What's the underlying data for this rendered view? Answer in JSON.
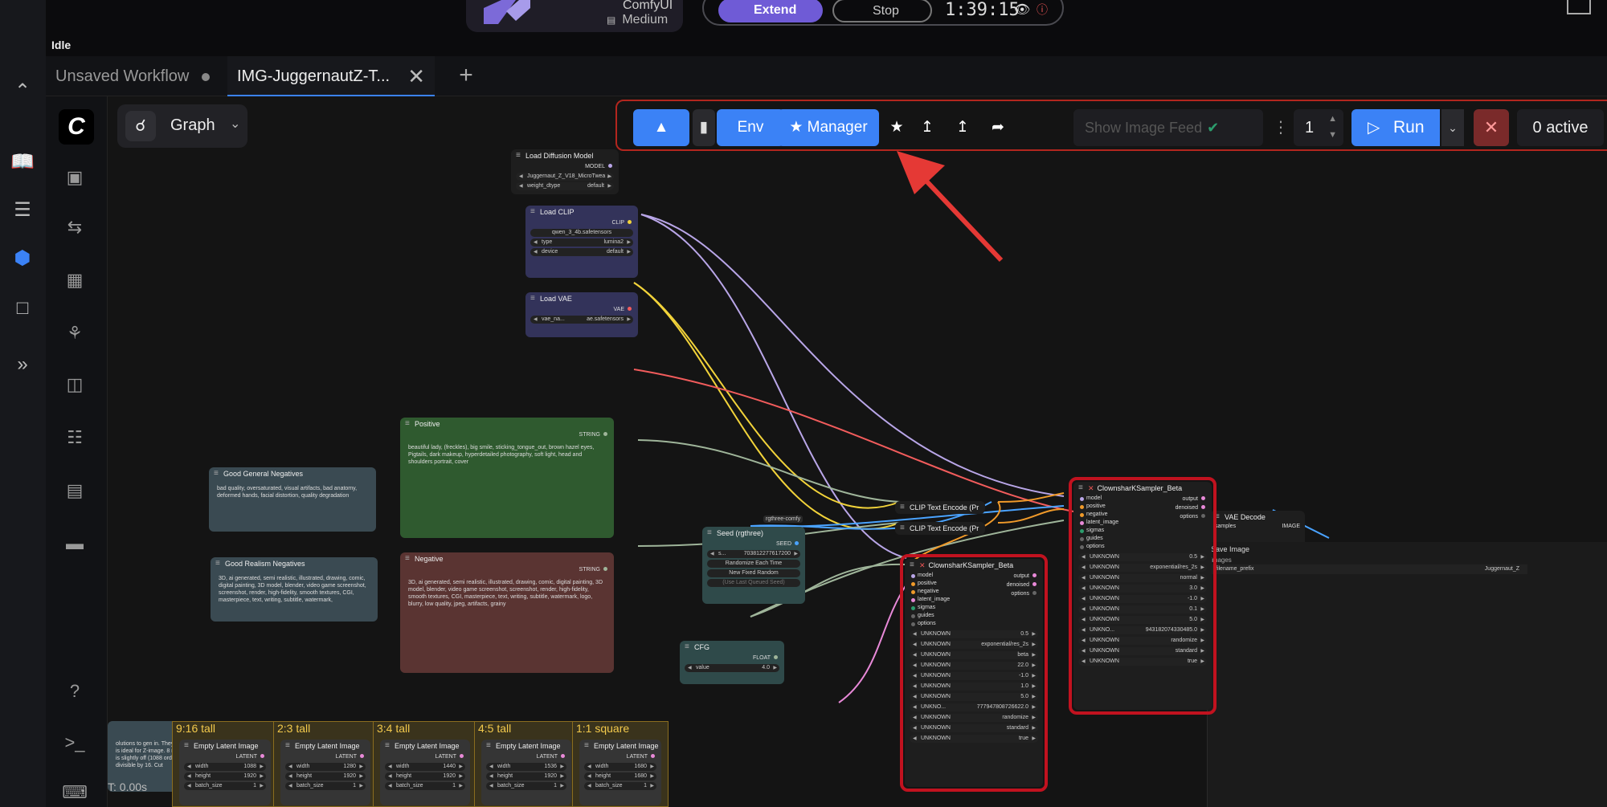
{
  "top": {
    "brand_name": "ComfyUI",
    "tier": "Medium",
    "extend_label": "Extend",
    "stop_label": "Stop",
    "timer": "1:39:15",
    "status": "Idle"
  },
  "tabs": [
    {
      "label": "Unsaved Workflow"
    },
    {
      "label": "IMG-JuggernautZ-T..."
    }
  ],
  "graph_menu": {
    "label": "Graph"
  },
  "toolbar": {
    "env_label": "Env",
    "manager_label": "Manager",
    "image_feed_label": "Show Image Feed",
    "queue_count": "1",
    "run_label": "Run",
    "active_label": "0 active"
  },
  "nodes": {
    "load_diffusion": {
      "title": "Load Diffusion Model",
      "out": "MODEL",
      "w1": "Juggernaut_Z_V18_MicroTwea ...",
      "w2l": "weight_dtype",
      "w2r": "default"
    },
    "load_clip": {
      "title": "Load CLIP",
      "out": "CLIP",
      "w1": "qwen_3_4b.safetensors",
      "w2l": "type",
      "w2r": "lumina2",
      "w3l": "device",
      "w3r": "default"
    },
    "load_vae": {
      "title": "Load VAE",
      "out": "VAE",
      "w1l": "vae_na...",
      "w1r": "ae.safetensors"
    },
    "positive": {
      "title": "Positive",
      "out": "STRING",
      "text": "beautiful lady, (freckles), big smile, sticking_tongue_out, brown hazel eyes, Pigtails, dark makeup, hyperdetailed photography, soft light, head and shoulders portrait, cover"
    },
    "negative": {
      "title": "Negative",
      "out": "STRING",
      "text": "3D, ai generated, semi realistic, illustrated, drawing, comic, digital painting, 3D model, blender, video game screenshot, screenshot, render, high-fidelity, smooth textures, CGI, masterpiece, text, writing, subtitle, watermark, logo, blurry, low quality, jpeg, artifacts, grainy"
    },
    "good_general": {
      "title": "Good General Negatives",
      "text": "bad quality, oversaturated, visual artifacts, bad anatomy, deformed hands, facial distortion, quality degradation"
    },
    "good_realism": {
      "title": "Good Realism Negatives",
      "text": "3D, ai generated, semi realistic, illustrated, drawing, comic, digital painting, 3D model, blender, video game screenshot, screenshot, render, high-fidelity, smooth textures, CGI, masterpiece, text, writing, subtitle, watermark,"
    },
    "seed": {
      "badge": "rgthree-comfy",
      "title": "Seed (rgthree)",
      "out": "SEED",
      "w1l": "s...",
      "w1r": "703812277617200",
      "b1": "Randomize Each Time",
      "b2": "New Fixed Random",
      "b3": "(Use Last Queued Seed)"
    },
    "cfg": {
      "title": "CFG",
      "out": "FLOAT",
      "wl": "value",
      "wr": "4.0"
    },
    "clip_enc1": {
      "title": "CLIP Text Encode (Pr"
    },
    "clip_enc2": {
      "title": "CLIP Text Encode (Pr"
    },
    "vae_decode": {
      "title": "VAE Decode",
      "in": "samples",
      "out": "IMAGE"
    },
    "save_image": {
      "title": "Save Image",
      "images": "images",
      "wl": "filename_prefix",
      "wr": "Juggernaut_Z"
    },
    "sampler1": {
      "title": "ClownsharKSampler_Beta",
      "inputs": [
        "model",
        "positive",
        "negative",
        "latent_image",
        "sigmas",
        "guides",
        "options"
      ],
      "outputs": [
        "output",
        "denoised",
        "options"
      ],
      "widgets": [
        [
          "UNKNOWN",
          "0.5"
        ],
        [
          "UNKNOWN",
          "exponential/res_2s"
        ],
        [
          "UNKNOWN",
          "beta"
        ],
        [
          "UNKNOWN",
          "22.0"
        ],
        [
          "UNKNOWN",
          "-1.0"
        ],
        [
          "UNKNOWN",
          "1.0"
        ],
        [
          "UNKNOWN",
          "5.0"
        ],
        [
          "UNKNO...",
          "777947808726622.0"
        ],
        [
          "UNKNOWN",
          "randomize"
        ],
        [
          "UNKNOWN",
          "standard"
        ],
        [
          "UNKNOWN",
          "true"
        ]
      ]
    },
    "sampler2": {
      "title": "ClownsharKSampler_Beta",
      "inputs": [
        "model",
        "positive",
        "negative",
        "latent_image",
        "sigmas",
        "guides",
        "options"
      ],
      "outputs": [
        "output",
        "denoised",
        "options"
      ],
      "widgets": [
        [
          "UNKNOWN",
          "0.5"
        ],
        [
          "UNKNOWN",
          "exponential/res_2s"
        ],
        [
          "UNKNOWN",
          "normal"
        ],
        [
          "UNKNOWN",
          "3.0"
        ],
        [
          "UNKNOWN",
          "-1.0"
        ],
        [
          "UNKNOWN",
          "0.1"
        ],
        [
          "UNKNOWN",
          "5.0"
        ],
        [
          "UNKNO...",
          "943182074330485.0"
        ],
        [
          "UNKNOWN",
          "randomize"
        ],
        [
          "UNKNOWN",
          "standard"
        ],
        [
          "UNKNOWN",
          "true"
        ]
      ]
    }
  },
  "groups": [
    {
      "label": "9:16 tall",
      "node": "Empty Latent Image",
      "width": "1088",
      "height": "1920",
      "batch": "1"
    },
    {
      "label": "2:3 tall",
      "node": "Empty Latent Image",
      "width": "1280",
      "height": "1920",
      "batch": "1"
    },
    {
      "label": "3:4 tall",
      "node": "Empty Latent Image",
      "width": "1440",
      "height": "1920",
      "batch": "1"
    },
    {
      "label": "4:5 tall",
      "node": "Empty Latent Image",
      "width": "1536",
      "height": "1920",
      "batch": "1"
    },
    {
      "label": "1:1 square",
      "node": "Empty Latent Image",
      "width": "1680",
      "height": "1680",
      "batch": "1"
    }
  ],
  "latent_labels": {
    "out": "LATENT",
    "w": "width",
    "h": "height",
    "b": "batch_size"
  },
  "note": {
    "text": "olutions to gen in. They are all h is ideal for Z-image. 8 resolution is slightly off (1088 order to be divisible by 16. Cut"
  },
  "timing": "T: 0.00s",
  "colors": {
    "accent": "#3b82f6",
    "highlight": "#c1121f",
    "arrow": "#e53935"
  }
}
